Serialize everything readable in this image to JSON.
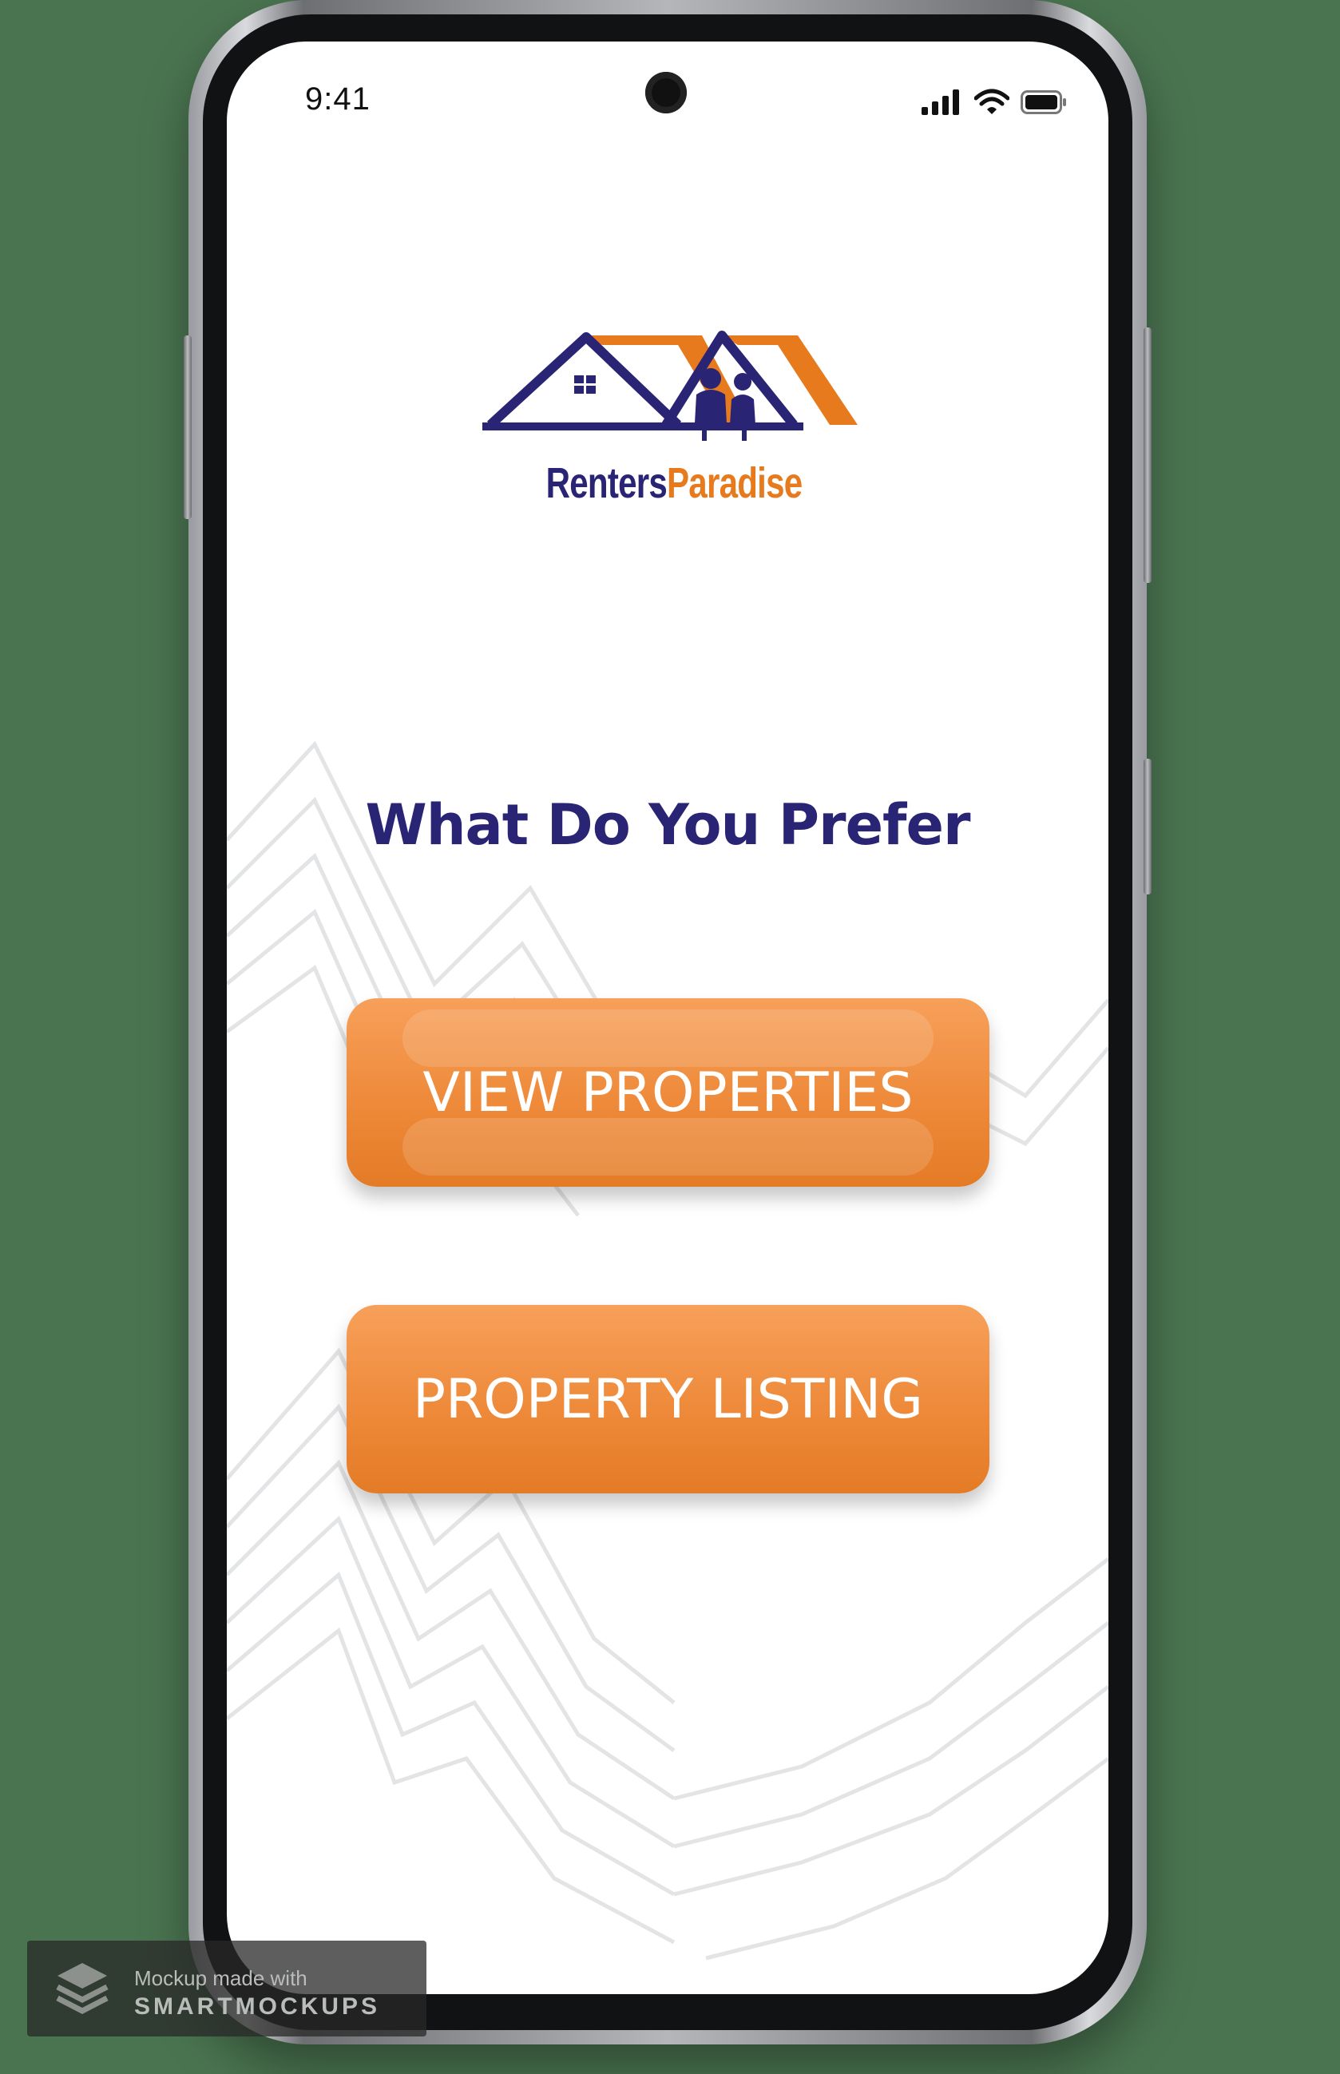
{
  "status_bar": {
    "time": "9:41",
    "icons": [
      "signal-icon",
      "wifi-icon",
      "battery-icon"
    ]
  },
  "logo": {
    "text_part1": "Renters",
    "text_part2": "Paradise"
  },
  "main": {
    "heading": "What Do You Prefer",
    "buttons": [
      {
        "label": "VIEW PROPERTIES"
      },
      {
        "label": "PROPERTY LISTING"
      }
    ]
  },
  "watermark": {
    "line1": "Mockup made with",
    "line2": "SMARTMOCKUPS"
  },
  "colors": {
    "background": "#4a7450",
    "brand_navy": "#2a2475",
    "brand_orange": "#e87a1e",
    "button_orange": "#ee8a3a"
  }
}
